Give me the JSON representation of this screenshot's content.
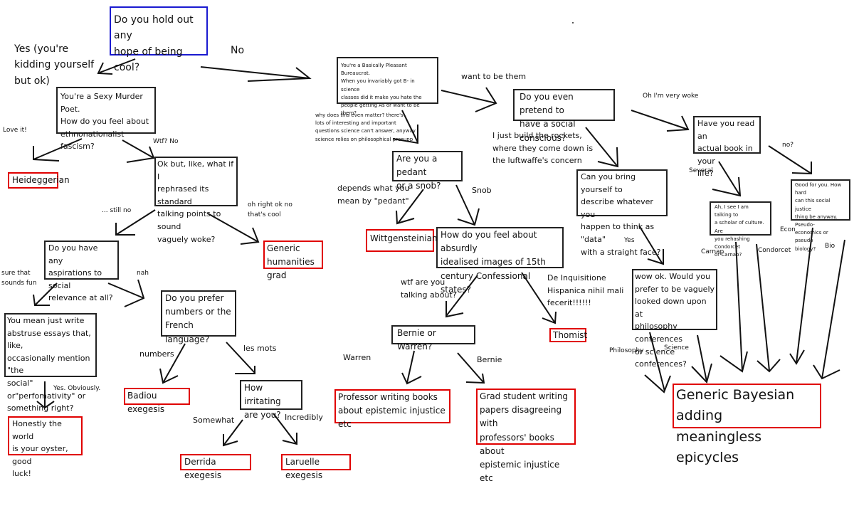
{
  "nodes": {
    "start": "Do you hold out any\nhope of being cool?",
    "sexy_poet": "You're a Sexy Murder Poet.\nHow do you feel about\nethnonationalist fascism?",
    "bureaucrat": "You're a Basically Pleasant Bureaucrat.\nWhen you invariably got B- in science\nclasses did it make you hate the\npeople getting As or want to be them?",
    "rephrase": "Ok but, like, what if I\nrephrased its  standard\ntalking points to sound\nvaguely woke?",
    "aspirations": "Do you have any\naspirations to social\nrelevance at all?",
    "abstruse": "You mean just write\nabstruse essays that, like,\noccasionally mention \"the\nsocial\" or\"perfomativity\" or\nsomething right?",
    "numbers_french": "Do you prefer\nnumbers or the\nFrench language?",
    "irritating": "How irritating\nare you?",
    "pedant_snob": "Are you a pedant\nor a snob?",
    "confessional": "How do you feel about absurdly\nidealised images of 15th\ncentury Confessional states?",
    "bernie_warren": "Bernie or Warren?",
    "social_conscious": "Do you even pretend to\nhave a social conscious?",
    "data": "Can you bring yourself to\ndescribe whatever you\nhappen to think as \"data\"\nwith a straight face?",
    "conferences": "wow ok. Would you\nprefer to be vaguely\nlooked down upon at\nphilosophy conferences\nor science conferences?",
    "actual_book": "Have you read an\nactual book in your\nlife?",
    "scholar": "Ah, I see I am talking to\na scholar of culture. Are\nyou rehashing Condorcet\nor Carnap?",
    "good_for_you": "Good for you. How hard\ncan this social justice\nthing be anyway. Pseudo-\neconomics or pseudo\nbiology?"
  },
  "outcomes": {
    "heideggerian": "Heideggerian",
    "humanities_grad": "Generic\nhumanities grad",
    "oyster": "Honestly the world\nis your oyster, good\nluck!",
    "badiou": "Badiou exegesis",
    "derrida": "Derrida exegesis",
    "laruelle": "Laruelle exegesis",
    "wittgensteinian": "Wittgensteinian",
    "thomist": "Thomist",
    "professor": "Professor writing books\nabout epistemic injustice etc",
    "grad_student": "Grad student writing\npapers disagreeing with\nprofessors' books about\nepistemic injustice etc",
    "bayesian": "Generic Bayesian adding\nmeaningless epicycles"
  },
  "edges": {
    "yes_cool": "Yes (you're\nkidding yourself\nbut ok)",
    "no_cool": "No",
    "love_it": "Love it!",
    "wtf_no": "Wtf? No",
    "still_no": "... still no",
    "oh_right": "oh right ok no\nthat's cool",
    "sure_fun": "sure that\nsounds fun",
    "nah": "nah",
    "yes_obviously": "Yes. Obviously.",
    "numbers": "numbers",
    "les_mots": "les mots",
    "somewhat": "Somewhat",
    "incredibly": "Incredibly",
    "why_matter": "why does this even matter? there's\nlots of interesting and important\nquestions science can't answer, anyway\nscience relies on philosophical presupp",
    "want_to_be": "want to be them",
    "depends": "depends what you\nmean by \"pedant\"",
    "snob": "Snob",
    "wtf_talking": "wtf are you\ntalking about?",
    "inquisition": "De Inquisitione\nHispanica nihil mali\nfecerit!!!!!!",
    "warren": "Warren",
    "bernie": "Bernie",
    "rockets": "I just build the rockets,\nwhere they come down is\nthe luftwaffe's concern",
    "woke": "Oh I'm very woke",
    "yes_data": "Yes",
    "several": "Several",
    "no_book": "no?",
    "philosophy": "Philosophy",
    "science": "Science",
    "carnap": "Carnap",
    "condorcet": "Condorcet",
    "econ": "Econ",
    "bio": "Bio"
  },
  "colors": {
    "question_border": "#222222",
    "outcome_border": "#e00000",
    "start_border": "#1a1ad0"
  }
}
